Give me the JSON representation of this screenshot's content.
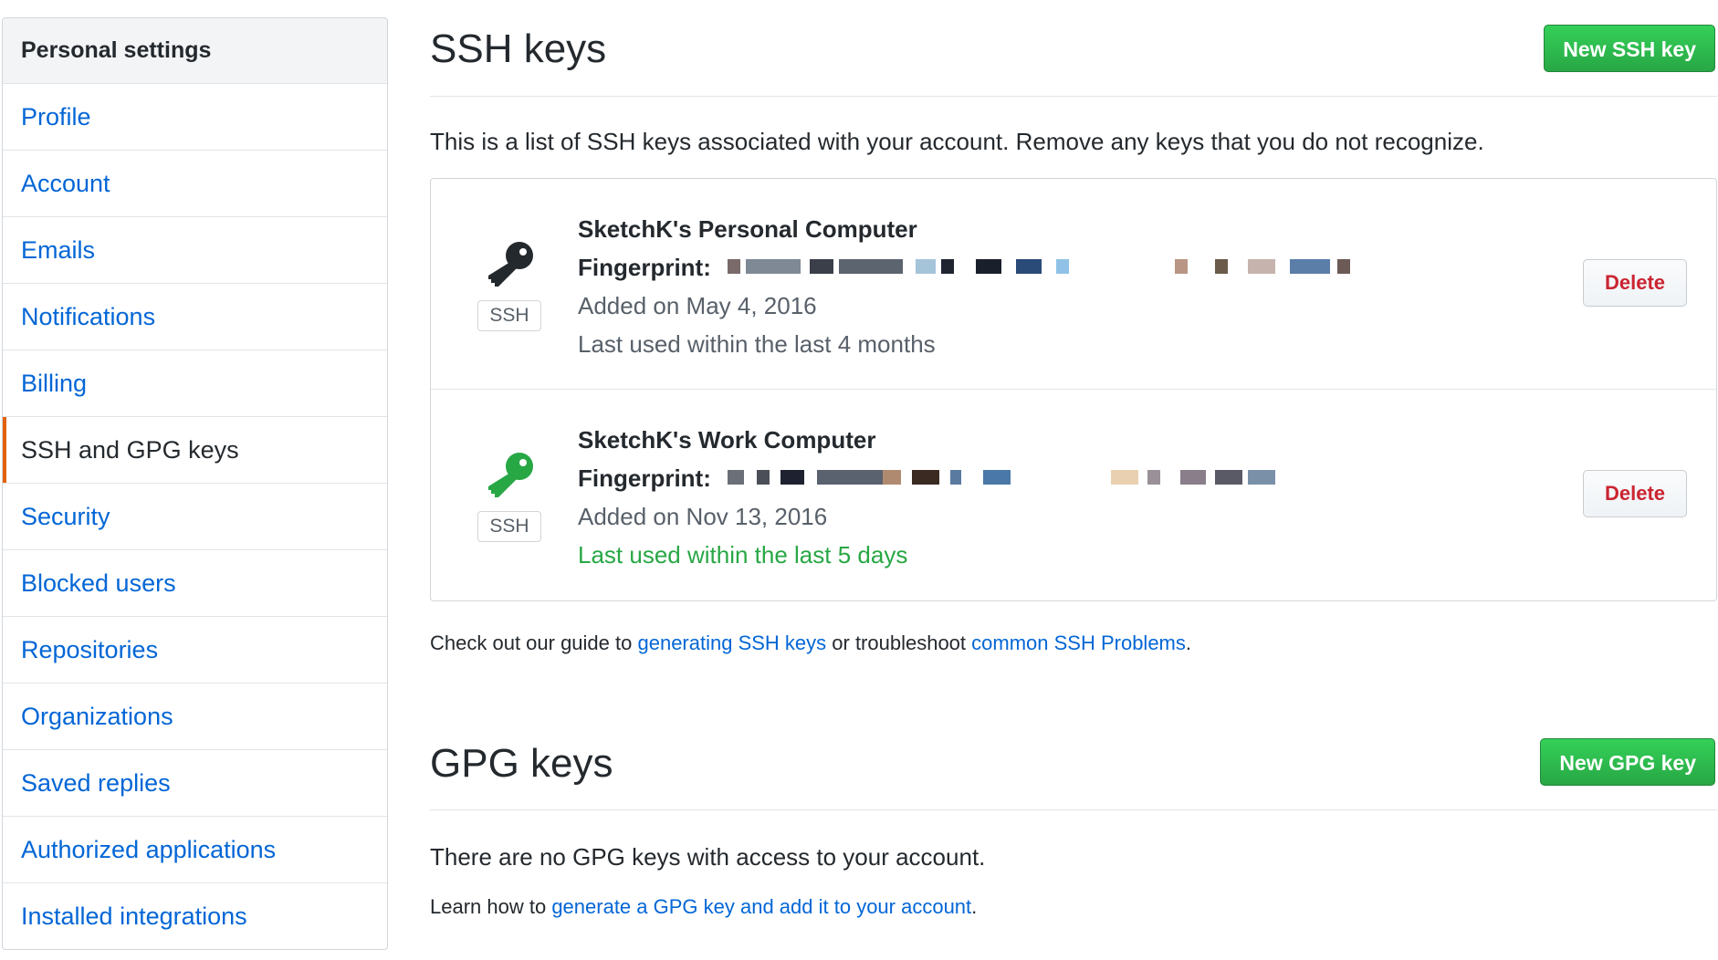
{
  "sidebar": {
    "header": "Personal settings",
    "items": [
      {
        "label": "Profile",
        "name": "sidebar-item-profile"
      },
      {
        "label": "Account",
        "name": "sidebar-item-account"
      },
      {
        "label": "Emails",
        "name": "sidebar-item-emails"
      },
      {
        "label": "Notifications",
        "name": "sidebar-item-notifications"
      },
      {
        "label": "Billing",
        "name": "sidebar-item-billing"
      },
      {
        "label": "SSH and GPG keys",
        "name": "sidebar-item-ssh-gpg-keys",
        "selected": true
      },
      {
        "label": "Security",
        "name": "sidebar-item-security"
      },
      {
        "label": "Blocked users",
        "name": "sidebar-item-blocked-users"
      },
      {
        "label": "Repositories",
        "name": "sidebar-item-repositories"
      },
      {
        "label": "Organizations",
        "name": "sidebar-item-organizations"
      },
      {
        "label": "Saved replies",
        "name": "sidebar-item-saved-replies"
      },
      {
        "label": "Authorized applications",
        "name": "sidebar-item-authorized-applications"
      },
      {
        "label": "Installed integrations",
        "name": "sidebar-item-installed-integrations"
      }
    ]
  },
  "ssh": {
    "title": "SSH keys",
    "new_button": "New SSH key",
    "intro": "This is a list of SSH keys associated with your account. Remove any keys that you do not recognize.",
    "keys": [
      {
        "title": "SketchK's Personal Computer",
        "fingerprint_label": "Fingerprint:",
        "added": "Added on May 4, 2016",
        "last_used": "Last used within the last 4 months",
        "badge": "SSH",
        "delete_label": "Delete",
        "icon": "key-icon",
        "icon_color": "#24292e"
      },
      {
        "title": "SketchK's Work Computer",
        "fingerprint_label": "Fingerprint:",
        "added": "Added on Nov 13, 2016",
        "last_used": "Last used within the last 5 days",
        "badge": "SSH",
        "delete_label": "Delete",
        "icon": "key-icon",
        "icon_color": "#28a745"
      }
    ],
    "guide": {
      "prefix": "Check out our guide to ",
      "link1": "generating SSH keys",
      "middle": " or troubleshoot ",
      "link2": "common SSH Problems",
      "suffix": "."
    }
  },
  "gpg": {
    "title": "GPG keys",
    "new_button": "New GPG key",
    "empty_text": "There are no GPG keys with access to your account.",
    "learn": {
      "prefix": "Learn how to ",
      "link": "generate a GPG key and add it to your account",
      "suffix": "."
    }
  },
  "colors": {
    "link": "#0366d6",
    "green": "#28a745",
    "danger": "#cb2431",
    "selected_marker": "#e36209"
  }
}
